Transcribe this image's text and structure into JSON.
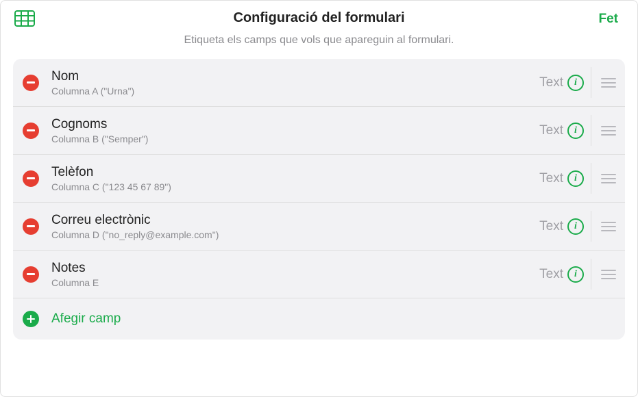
{
  "header": {
    "title": "Configuració del formulari",
    "done_label": "Fet",
    "subtitle": "Etiqueta els camps que vols que apareguin al formulari."
  },
  "fields": [
    {
      "title": "Nom",
      "subtitle": "Columna A (\"Urna\")",
      "type": "Text"
    },
    {
      "title": "Cognoms",
      "subtitle": "Columna B (\"Semper\")",
      "type": "Text"
    },
    {
      "title": "Telèfon",
      "subtitle": "Columna C (\"123 45 67 89\")",
      "type": "Text"
    },
    {
      "title": "Correu electrònic",
      "subtitle": "Columna D (\"no_reply@example.com\")",
      "type": "Text"
    },
    {
      "title": "Notes",
      "subtitle": "Columna E",
      "type": "Text"
    }
  ],
  "add_field_label": "Afegir camp",
  "info_char": "i"
}
